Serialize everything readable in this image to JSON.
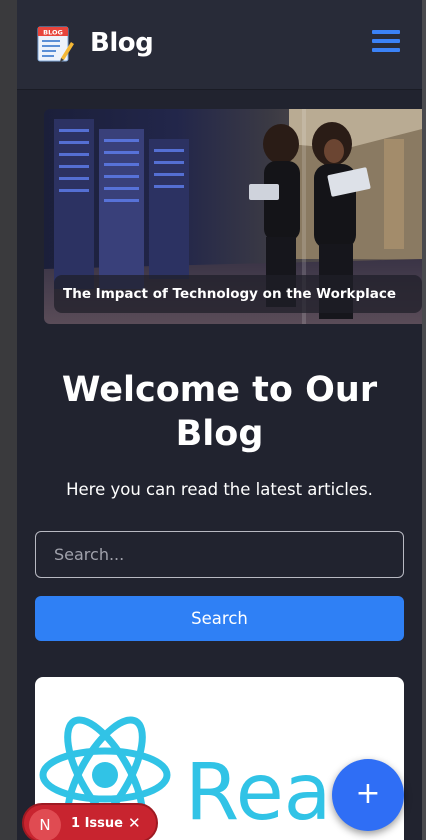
{
  "header": {
    "brand": "Blog",
    "logo_icon": "blog-notepad-icon",
    "menu_icon": "hamburger-menu-icon"
  },
  "hero": {
    "caption": "The Impact of Technology on the Workplace"
  },
  "main": {
    "heading": "Welcome to Our Blog",
    "subtitle": "Here you can read the latest articles.",
    "search_placeholder": "Search...",
    "search_button": "Search"
  },
  "card": {
    "logo_text": "Rea",
    "icon": "react-logo-icon"
  },
  "fab": {
    "label": "+"
  },
  "devtools": {
    "avatar": "N",
    "issue_label": "1 Issue",
    "close": "✕"
  },
  "colors": {
    "background": "#21232f",
    "header": "#282b38",
    "accent": "#2f80f5",
    "react": "#31c3e6",
    "issue": "#c8242f"
  }
}
